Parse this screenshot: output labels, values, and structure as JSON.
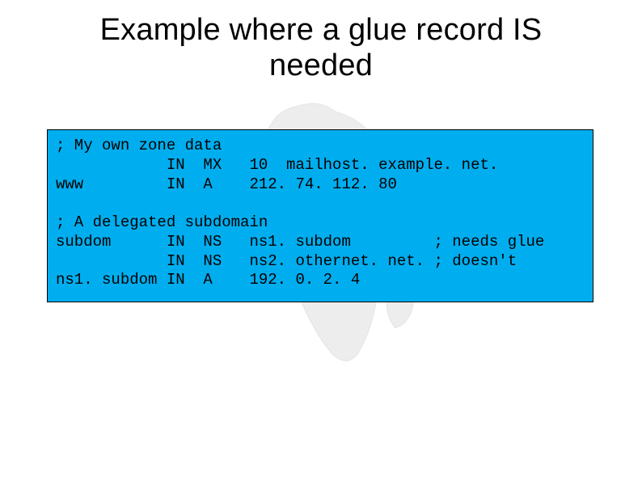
{
  "title_line1": "Example where a glue record IS",
  "title_line2": "needed",
  "code": {
    "l1": "; My own zone data",
    "l2": "            IN  MX   10  mailhost. example. net.",
    "l3": "www         IN  A    212. 74. 112. 80",
    "l4": "",
    "l5": "; A delegated subdomain",
    "l6": "subdom      IN  NS   ns1. subdom         ; needs glue",
    "l7": "            IN  NS   ns2. othernet. net. ; doesn't",
    "l8": "ns1. subdom IN  A    192. 0. 2. 4"
  }
}
